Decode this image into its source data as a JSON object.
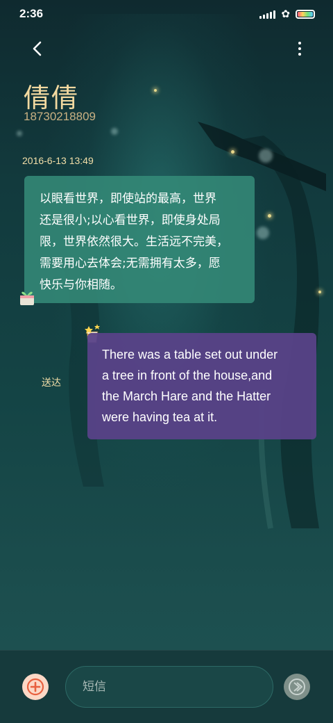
{
  "status_bar": {
    "time": "2:36",
    "icons": [
      "signal-icon",
      "clover-icon",
      "battery-icon"
    ]
  },
  "header": {
    "contact_name": "倩倩",
    "contact_number": "18730218809",
    "back_icon": "chevron-left-icon",
    "menu_icon": "more-vertical-icon"
  },
  "conversation": {
    "timestamp": "2016-6-13 13:49",
    "messages": [
      {
        "direction": "incoming",
        "lines": [
          "以眼看世界，即使站的最高，世界",
          "还是很小;以心看世界，即使身处局",
          "限，世界依然很大。生活远不完美，",
          "需要用心去体会;无需拥有太多，愿",
          "快乐与你相随。"
        ]
      },
      {
        "direction": "outgoing",
        "lines": [
          "There was a table set out under",
          "a tree in front of the house,and",
          "the March Hare and the Hatter",
          "were having tea at it."
        ],
        "status": "送达"
      }
    ]
  },
  "composer": {
    "placeholder": "短信",
    "add_icon": "plus-icon",
    "send_icon": "send-arrow-icon"
  },
  "colors": {
    "incoming_bubble": "#348a78",
    "outgoing_bubble": "#584288",
    "accent_gold": "#f3dfa8"
  }
}
